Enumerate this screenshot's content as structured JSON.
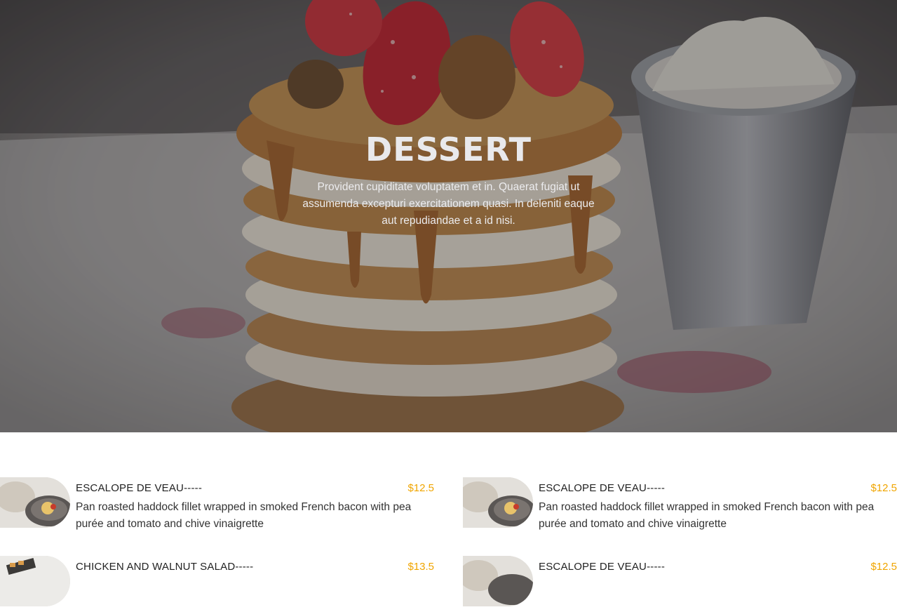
{
  "hero": {
    "title": "DESSERT",
    "text": "Provident cupiditate voluptatem et in. Quaerat fugiat ut assumenda excepturi exercitationem quasi. In deleniti eaque aut repudiandae et a id nisi."
  },
  "menu": {
    "items": [
      {
        "name": "ESCALOPE DE VEAU-----",
        "price": "$12.5",
        "description": "Pan roasted haddock fillet wrapped in smoked French bacon with pea purée and tomato and chive vinaigrette"
      },
      {
        "name": "ESCALOPE DE VEAU-----",
        "price": "$12.5",
        "description": "Pan roasted haddock fillet wrapped in smoked French bacon with pea purée and tomato and chive vinaigrette"
      },
      {
        "name": "CHICKEN AND WALNUT SALAD-----",
        "price": "$13.5",
        "description": ""
      },
      {
        "name": "ESCALOPE DE VEAU-----",
        "price": "$12.5",
        "description": ""
      }
    ]
  },
  "colors": {
    "price": "#f0a500",
    "hero_title": "#e9e9ec"
  }
}
